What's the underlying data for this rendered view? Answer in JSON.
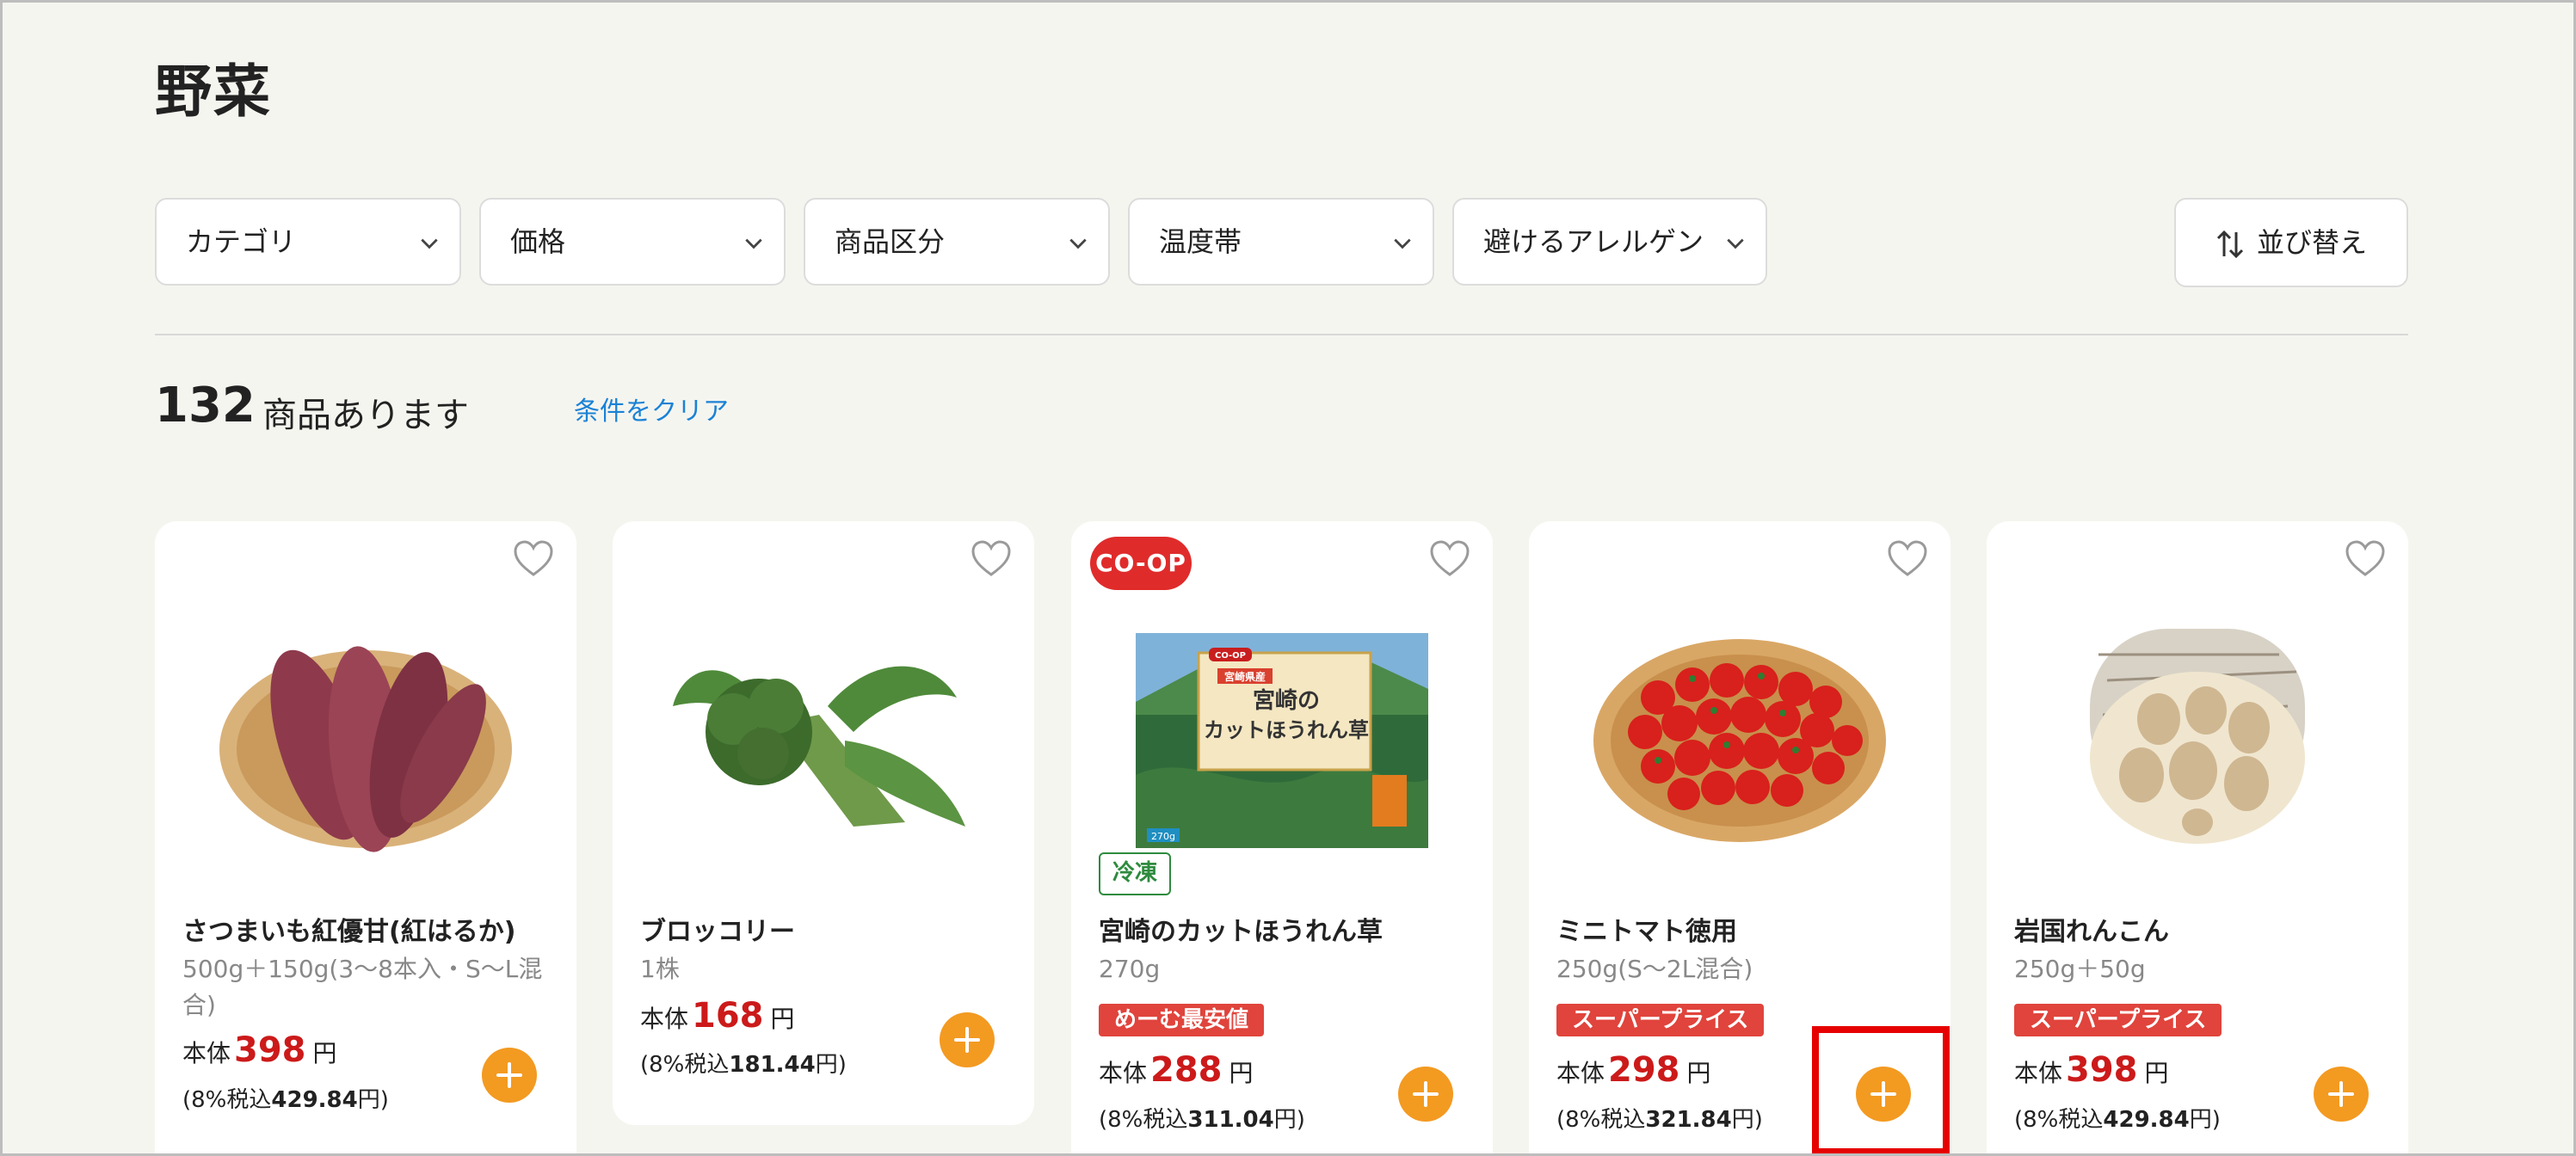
{
  "page": {
    "title": "野菜"
  },
  "filters": [
    {
      "label": "カテゴリ"
    },
    {
      "label": "価格"
    },
    {
      "label": "商品区分"
    },
    {
      "label": "温度帯"
    },
    {
      "label": "避けるアレルゲン"
    }
  ],
  "sort": {
    "label": "並び替え"
  },
  "results": {
    "count": "132",
    "label": "商品あります",
    "clear_label": "条件をクリア"
  },
  "products": [
    {
      "name": "さつまいも紅優甘(紅はるか)",
      "size": "500g＋150g(3～8本入・S～L混合)",
      "price_prefix": "本体",
      "price": "398",
      "price_suffix": "円",
      "tax_prefix": "(8%税込",
      "tax_value": "429.84",
      "tax_suffix": "円)"
    },
    {
      "name": "ブロッコリー",
      "size": "1株",
      "price_prefix": "本体",
      "price": "168",
      "price_suffix": "円",
      "tax_prefix": "(8%税込",
      "tax_value": "181.44",
      "tax_suffix": "円)"
    },
    {
      "name": "宮崎のカットほうれん草",
      "size": "270g",
      "badge": "CO-OP",
      "temp": "冷凍",
      "tag": "めーむ最安値",
      "price_prefix": "本体",
      "price": "288",
      "price_suffix": "円",
      "tax_prefix": "(8%税込",
      "tax_value": "311.04",
      "tax_suffix": "円)",
      "package": {
        "top": "CO-OP",
        "region": "宮崎県産",
        "line1": "宮崎の",
        "line2": "カットほうれん草",
        "weight": "270g"
      }
    },
    {
      "name": "ミニトマト徳用",
      "size": "250g(S～2L混合)",
      "tag": "スーパープライス",
      "price_prefix": "本体",
      "price": "298",
      "price_suffix": "円",
      "tax_prefix": "(8%税込",
      "tax_value": "321.84",
      "tax_suffix": "円)"
    },
    {
      "name": "岩国れんこん",
      "size": "250g＋50g",
      "tag": "スーパープライス",
      "price_prefix": "本体",
      "price": "398",
      "price_suffix": "円",
      "tax_prefix": "(8%税込",
      "tax_value": "429.84",
      "tax_suffix": "円)"
    }
  ],
  "colors": {
    "accent": "#f39a21",
    "price": "#cc1a1a",
    "tag": "#e0443c",
    "link": "#1a82d6",
    "highlight": "#e60000"
  },
  "icons": {
    "favorite": "heart-icon",
    "add": "plus-icon",
    "dropdown": "chevron-down-icon",
    "sort": "sort-arrows-icon"
  }
}
